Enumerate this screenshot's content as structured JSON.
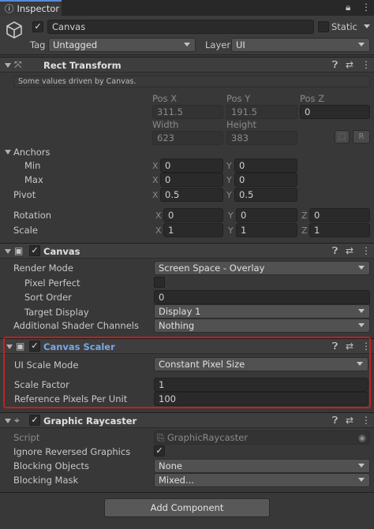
{
  "tab": {
    "title": "Inspector"
  },
  "object": {
    "name": "Canvas",
    "static_label": "Static",
    "tag_label": "Tag",
    "tag_value": "Untagged",
    "layer_label": "Layer",
    "layer_value": "UI"
  },
  "rect_transform": {
    "title": "Rect Transform",
    "note": "Some values driven by Canvas.",
    "pos_x_label": "Pos X",
    "pos_y_label": "Pos Y",
    "pos_z_label": "Pos Z",
    "pos_x": "311.5",
    "pos_y": "191.5",
    "pos_z": "0",
    "width_label": "Width",
    "height_label": "Height",
    "width": "623",
    "height": "383",
    "r_button": "R",
    "anchors_label": "Anchors",
    "min_label": "Min",
    "min_x": "0",
    "min_y": "0",
    "max_label": "Max",
    "max_x": "0",
    "max_y": "0",
    "pivot_label": "Pivot",
    "pivot_x": "0.5",
    "pivot_y": "0.5",
    "rotation_label": "Rotation",
    "rot_x": "0",
    "rot_y": "0",
    "rot_z": "0",
    "scale_label": "Scale",
    "scale_x": "1",
    "scale_y": "1",
    "scale_z": "1",
    "x": "X",
    "y": "Y",
    "z": "Z"
  },
  "canvas": {
    "title": "Canvas",
    "render_mode_label": "Render Mode",
    "render_mode": "Screen Space - Overlay",
    "pixel_perfect_label": "Pixel Perfect",
    "sort_order_label": "Sort Order",
    "sort_order": "0",
    "target_display_label": "Target Display",
    "target_display": "Display 1",
    "shader_channels_label": "Additional Shader Channels",
    "shader_channels": "Nothing"
  },
  "canvas_scaler": {
    "title": "Canvas Scaler",
    "ui_scale_mode_label": "UI Scale Mode",
    "ui_scale_mode": "Constant Pixel Size",
    "scale_factor_label": "Scale Factor",
    "scale_factor": "1",
    "ref_ppu_label": "Reference Pixels Per Unit",
    "ref_ppu": "100"
  },
  "graphic_raycaster": {
    "title": "Graphic Raycaster",
    "script_label": "Script",
    "script": "GraphicRaycaster",
    "ignore_reversed_label": "Ignore Reversed Graphics",
    "blocking_objects_label": "Blocking Objects",
    "blocking_objects": "None",
    "blocking_mask_label": "Blocking Mask",
    "blocking_mask": "Mixed..."
  },
  "add_component": "Add Component",
  "colors": {
    "highlight": "#c61e1e",
    "title_blue": "#7aa7e8",
    "accent": "#5a8bd6"
  }
}
